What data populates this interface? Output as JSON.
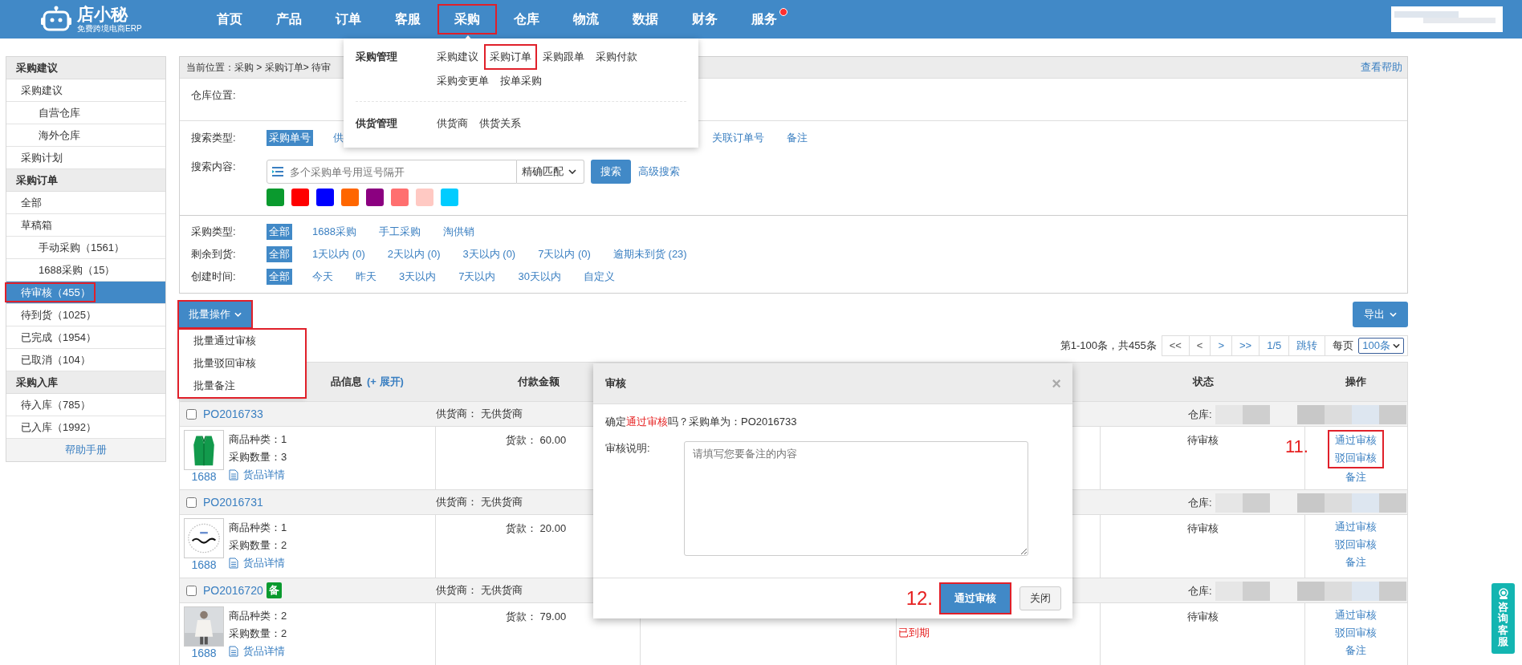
{
  "top_nav": {
    "logo_name": "店小秘",
    "logo_tagline": "免费跨境电商ERP",
    "items": [
      {
        "label": "首页",
        "expanded": false,
        "marked": false,
        "dot": false
      },
      {
        "label": "产品",
        "expanded": false,
        "marked": false,
        "dot": false
      },
      {
        "label": "订单",
        "expanded": false,
        "marked": false,
        "dot": false
      },
      {
        "label": "客服",
        "expanded": false,
        "marked": false,
        "dot": false
      },
      {
        "label": "采购",
        "expanded": true,
        "marked": true,
        "dot": false
      },
      {
        "label": "仓库",
        "expanded": false,
        "marked": false,
        "dot": false
      },
      {
        "label": "物流",
        "expanded": false,
        "marked": false,
        "dot": false
      },
      {
        "label": "数据",
        "expanded": false,
        "marked": false,
        "dot": false
      },
      {
        "label": "财务",
        "expanded": false,
        "marked": false,
        "dot": false
      },
      {
        "label": "服务",
        "expanded": false,
        "marked": false,
        "dot": true
      }
    ]
  },
  "nav_menu": {
    "groups": [
      {
        "title": "采购管理",
        "items": [
          {
            "label": "采购建议",
            "marked": false
          },
          {
            "label": "采购订单",
            "marked": true
          },
          {
            "label": "采购跟单",
            "marked": false
          },
          {
            "label": "采购付款",
            "marked": false
          },
          {
            "label": "采购变更单",
            "marked": false
          },
          {
            "label": "按单采购",
            "marked": false
          }
        ]
      },
      {
        "title": "供货管理",
        "items": [
          {
            "label": "供货商",
            "marked": false
          },
          {
            "label": "供货关系",
            "marked": false
          }
        ]
      }
    ]
  },
  "sidebar": {
    "sections": [
      {
        "title": "采购建议",
        "items": [
          {
            "label": "采购建议",
            "selected": false,
            "marked": false,
            "children": [
              {
                "label": "自营仓库",
                "selected": false,
                "marked": false
              },
              {
                "label": "海外仓库",
                "selected": false,
                "marked": false
              }
            ]
          },
          {
            "label": "采购计划",
            "selected": false,
            "marked": false
          }
        ]
      },
      {
        "title": "采购订单",
        "items": [
          {
            "label": "全部",
            "selected": false,
            "marked": false
          },
          {
            "label": "草稿箱",
            "selected": false,
            "marked": false,
            "children": [
              {
                "label": "手动采购（1561）",
                "selected": false,
                "marked": false
              },
              {
                "label": "1688采购（15）",
                "selected": false,
                "marked": false
              }
            ]
          },
          {
            "label": "待审核（455）",
            "selected": true,
            "marked": true
          },
          {
            "label": "待到货（1025）",
            "selected": false,
            "marked": false
          },
          {
            "label": "已完成（1954）",
            "selected": false,
            "marked": false
          },
          {
            "label": "已取消（104）",
            "selected": false,
            "marked": false
          }
        ]
      },
      {
        "title": "采购入库",
        "items": [
          {
            "label": "待入库（785）",
            "selected": false,
            "marked": false
          },
          {
            "label": "已入库（1992）",
            "selected": false,
            "marked": false
          }
        ]
      }
    ],
    "help_link": "帮助手册"
  },
  "breadcrumb": "当前位置：采购 > 采购订单> 待审",
  "help_link": "查看帮助",
  "warehouse_label": "仓库位置:",
  "search": {
    "type_label": "搜索类型:",
    "type_options": [
      {
        "label": "采购单号",
        "selected": true
      },
      {
        "label": "供",
        "selected": false
      }
    ],
    "type_options_more": [
      {
        "label": "关联订单号",
        "selected": false
      },
      {
        "label": "备注",
        "selected": false
      }
    ],
    "content_label": "搜索内容:",
    "placeholder": "多个采购单号用逗号隔开",
    "match_select": "精确匹配",
    "search_button": "搜索",
    "advanced_link": "高级搜索",
    "color_tags": [
      {
        "color": "#0a9a2e"
      },
      {
        "color": "#ff0000"
      },
      {
        "color": "#0000ff"
      },
      {
        "color": "#ff6600"
      },
      {
        "color": "#8b0080"
      },
      {
        "color": "#ff6f6f"
      },
      {
        "color": "#ffc9c3"
      },
      {
        "color": "#00ccff"
      }
    ]
  },
  "filters": [
    {
      "label": "采购类型:",
      "options": [
        {
          "label": "全部",
          "selected": true
        },
        {
          "label": "1688采购",
          "selected": false
        },
        {
          "label": "手工采购",
          "selected": false
        },
        {
          "label": "淘供销",
          "selected": false
        }
      ]
    },
    {
      "label": "剩余到货:",
      "options": [
        {
          "label": "全部",
          "selected": true
        },
        {
          "label": "1天以内 (0)",
          "selected": false
        },
        {
          "label": "2天以内 (0)",
          "selected": false
        },
        {
          "label": "3天以内 (0)",
          "selected": false
        },
        {
          "label": "7天以内 (0)",
          "selected": false
        },
        {
          "label": "逾期未到货 (23)",
          "selected": false
        }
      ]
    },
    {
      "label": "创建时间:",
      "options": [
        {
          "label": "全部",
          "selected": true
        },
        {
          "label": "今天",
          "selected": false
        },
        {
          "label": "昨天",
          "selected": false
        },
        {
          "label": "3天以内",
          "selected": false
        },
        {
          "label": "7天以内",
          "selected": false
        },
        {
          "label": "30天以内",
          "selected": false
        },
        {
          "label": "自定义",
          "selected": false
        }
      ]
    }
  ],
  "toolbar": {
    "batch_button": {
      "label": "批量操作",
      "marked": true
    },
    "batch_menu": [
      "批量通过审核",
      "批量驳回审核",
      "批量备注"
    ],
    "export_button": "导出"
  },
  "pagination": {
    "summary": "第1-100条，共455条",
    "buttons": [
      {
        "label": "<<",
        "disabled": true
      },
      {
        "label": "<",
        "disabled": true
      },
      {
        "label": ">",
        "disabled": false
      },
      {
        "label": ">>",
        "disabled": false
      },
      {
        "label": "1/5",
        "disabled": false
      },
      {
        "label": "跳转",
        "disabled": false
      }
    ],
    "per_page_label": "每页",
    "per_page": "100条"
  },
  "table": {
    "columns": [
      "品信息",
      "付款金额",
      "状态",
      "操作"
    ],
    "expand_link": "(+ 展开)",
    "rows": [
      {
        "checked": false,
        "order_no": "PO2016733",
        "supplier": "供货商：  无供货商",
        "warehouse_label": "仓库:",
        "categories": "商品种类：1",
        "quantity": "采购数量：3",
        "details_link": "货品详情",
        "source": "1688",
        "amount": "货款：  60.00",
        "status": "待审核",
        "annotation": "11.",
        "actions": [
          {
            "label": "通过审核",
            "marked": true
          },
          {
            "label": "驳回审核",
            "marked": true
          },
          {
            "label": "备注",
            "marked": false
          }
        ]
      },
      {
        "checked": false,
        "order_no": "PO2016731",
        "supplier": "供货商：  无供货商",
        "warehouse_label": "仓库:",
        "categories": "商品种类：1",
        "quantity": "采购数量：2",
        "details_link": "货品详情",
        "source": "1688",
        "amount": "货款：  20.00",
        "status": "待审核",
        "actions": [
          {
            "label": "通过审核",
            "marked": false
          },
          {
            "label": "驳回审核",
            "marked": false
          },
          {
            "label": "备注",
            "marked": false
          }
        ]
      },
      {
        "checked": false,
        "order_no": "PO2016720",
        "badge": "备",
        "supplier": "供货商：  无供货商",
        "warehouse_label": "仓库:",
        "categories": "商品种类：2",
        "quantity": "采购数量：2",
        "details_link": "货品详情",
        "source": "1688",
        "amount": "货款：  79.00",
        "expiry": "已到期",
        "status": "待审核",
        "actions": [
          {
            "label": "通过审核",
            "marked": false
          },
          {
            "label": "驳回审核",
            "marked": false
          },
          {
            "label": "备注",
            "marked": false
          }
        ]
      }
    ]
  },
  "dialog": {
    "title": "审核",
    "close": "×",
    "message_prefix": "确定",
    "message_highlight": "通过审核",
    "message_suffix": "吗？采购单为：PO2016733",
    "note_label": "审核说明:",
    "placeholder": "请填写您要备注的内容",
    "annotation": "12.",
    "confirm_button": {
      "label": "通过审核",
      "marked": true
    },
    "close_button": "关闭"
  },
  "side_widget": "咨询客服"
}
